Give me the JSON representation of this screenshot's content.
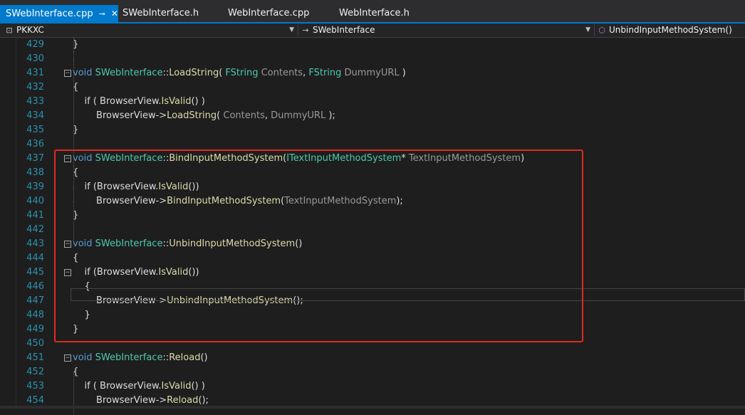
{
  "tabs": [
    {
      "label": "SWebInterface.cpp",
      "pin": "⊸",
      "close": "✕",
      "active": true
    },
    {
      "label": "SWebInterface.h",
      "active": false
    },
    {
      "label": "WebInterface.cpp",
      "active": false
    },
    {
      "label": "WebInterface.h",
      "active": false
    }
  ],
  "nav": {
    "project": {
      "icon": "project-icon",
      "label": "PKKXC"
    },
    "scope": {
      "icon": "arrow-right-icon",
      "label": "SWebInterface"
    },
    "member": {
      "icon": "method-cube-icon",
      "label": "UnbindInputMethodSystem()"
    }
  },
  "colors": {
    "accent": "#007acc",
    "highlight_box": "#e02a1f",
    "keyword": "#569cd6",
    "type": "#4ec9b0",
    "line_number": "#2b91af"
  },
  "lines": [
    {
      "n": "429",
      "t": [
        [
          "}",
          ""
        ]
      ]
    },
    {
      "n": "430",
      "t": []
    },
    {
      "n": "431",
      "fold": "−",
      "t": [
        [
          "void ",
          "kw"
        ],
        [
          "SWebInterface",
          "ty"
        ],
        [
          "::",
          ""
        ],
        [
          "LoadString",
          "fn"
        ],
        [
          "( ",
          ""
        ],
        [
          "FString",
          "ty"
        ],
        [
          " ",
          ""
        ],
        [
          "Contents",
          "pm"
        ],
        [
          ", ",
          ""
        ],
        [
          "FString",
          "ty"
        ],
        [
          " ",
          ""
        ],
        [
          "DummyURL",
          "pm"
        ],
        [
          " )",
          ""
        ]
      ]
    },
    {
      "n": "432",
      "t": [
        [
          "{",
          ""
        ]
      ]
    },
    {
      "n": "433",
      "t": [
        [
          "    if ( BrowserView.",
          ""
        ],
        [
          "IsValid",
          "fn"
        ],
        [
          "() )",
          ""
        ]
      ]
    },
    {
      "n": "434",
      "t": [
        [
          "        BrowserView->",
          ""
        ],
        [
          "LoadString",
          "fn"
        ],
        [
          "( ",
          ""
        ],
        [
          "Contents",
          "pm"
        ],
        [
          ", ",
          ""
        ],
        [
          "DummyURL",
          "pm"
        ],
        [
          " );",
          ""
        ]
      ]
    },
    {
      "n": "435",
      "t": [
        [
          "}",
          ""
        ]
      ]
    },
    {
      "n": "436",
      "t": []
    },
    {
      "n": "437",
      "fold": "−",
      "t": [
        [
          "void ",
          "kw"
        ],
        [
          "SWebInterface",
          "ty"
        ],
        [
          "::",
          ""
        ],
        [
          "BindInputMethodSystem",
          "fn"
        ],
        [
          "(",
          ""
        ],
        [
          "ITextInputMethodSystem",
          "ty"
        ],
        [
          "* ",
          ""
        ],
        [
          "TextInputMethodSystem",
          "pm"
        ],
        [
          ")",
          ""
        ]
      ]
    },
    {
      "n": "438",
      "t": [
        [
          "{",
          ""
        ]
      ]
    },
    {
      "n": "439",
      "t": [
        [
          "    if (BrowserView.",
          ""
        ],
        [
          "IsValid",
          "fn"
        ],
        [
          "())",
          ""
        ]
      ]
    },
    {
      "n": "440",
      "t": [
        [
          "        BrowserView->",
          ""
        ],
        [
          "BindInputMethodSystem",
          "fn"
        ],
        [
          "(",
          ""
        ],
        [
          "TextInputMethodSystem",
          "pm"
        ],
        [
          ");",
          ""
        ]
      ]
    },
    {
      "n": "441",
      "t": [
        [
          "}",
          ""
        ]
      ]
    },
    {
      "n": "442",
      "t": []
    },
    {
      "n": "443",
      "fold": "−",
      "t": [
        [
          "void ",
          "kw"
        ],
        [
          "SWebInterface",
          "ty"
        ],
        [
          "::",
          ""
        ],
        [
          "UnbindInputMethodSystem",
          "fn"
        ],
        [
          "()",
          ""
        ]
      ]
    },
    {
      "n": "444",
      "cur": true,
      "t": [
        [
          "{",
          ""
        ]
      ]
    },
    {
      "n": "445",
      "fold": "−",
      "t": [
        [
          "    if (BrowserView.",
          ""
        ],
        [
          "IsValid",
          "fn"
        ],
        [
          "())",
          ""
        ]
      ]
    },
    {
      "n": "446",
      "t": [
        [
          "    {",
          ""
        ]
      ]
    },
    {
      "n": "447",
      "t": [
        [
          "        BrowserView->",
          ""
        ],
        [
          "UnbindInputMethodSystem",
          "fn"
        ],
        [
          "();",
          ""
        ]
      ]
    },
    {
      "n": "448",
      "t": [
        [
          "    }",
          ""
        ]
      ]
    },
    {
      "n": "449",
      "t": [
        [
          "}",
          ""
        ]
      ]
    },
    {
      "n": "450",
      "t": []
    },
    {
      "n": "451",
      "fold": "−",
      "t": [
        [
          "void ",
          "kw"
        ],
        [
          "SWebInterface",
          "ty"
        ],
        [
          "::",
          ""
        ],
        [
          "Reload",
          "fn"
        ],
        [
          "()",
          ""
        ]
      ]
    },
    {
      "n": "452",
      "t": [
        [
          "{",
          ""
        ]
      ]
    },
    {
      "n": "453",
      "t": [
        [
          "    if ( BrowserView.",
          ""
        ],
        [
          "IsValid",
          "fn"
        ],
        [
          "() )",
          ""
        ]
      ]
    },
    {
      "n": "454",
      "t": [
        [
          "        BrowserView->",
          ""
        ],
        [
          "Reload",
          "fn"
        ],
        [
          "();",
          ""
        ]
      ]
    }
  ]
}
